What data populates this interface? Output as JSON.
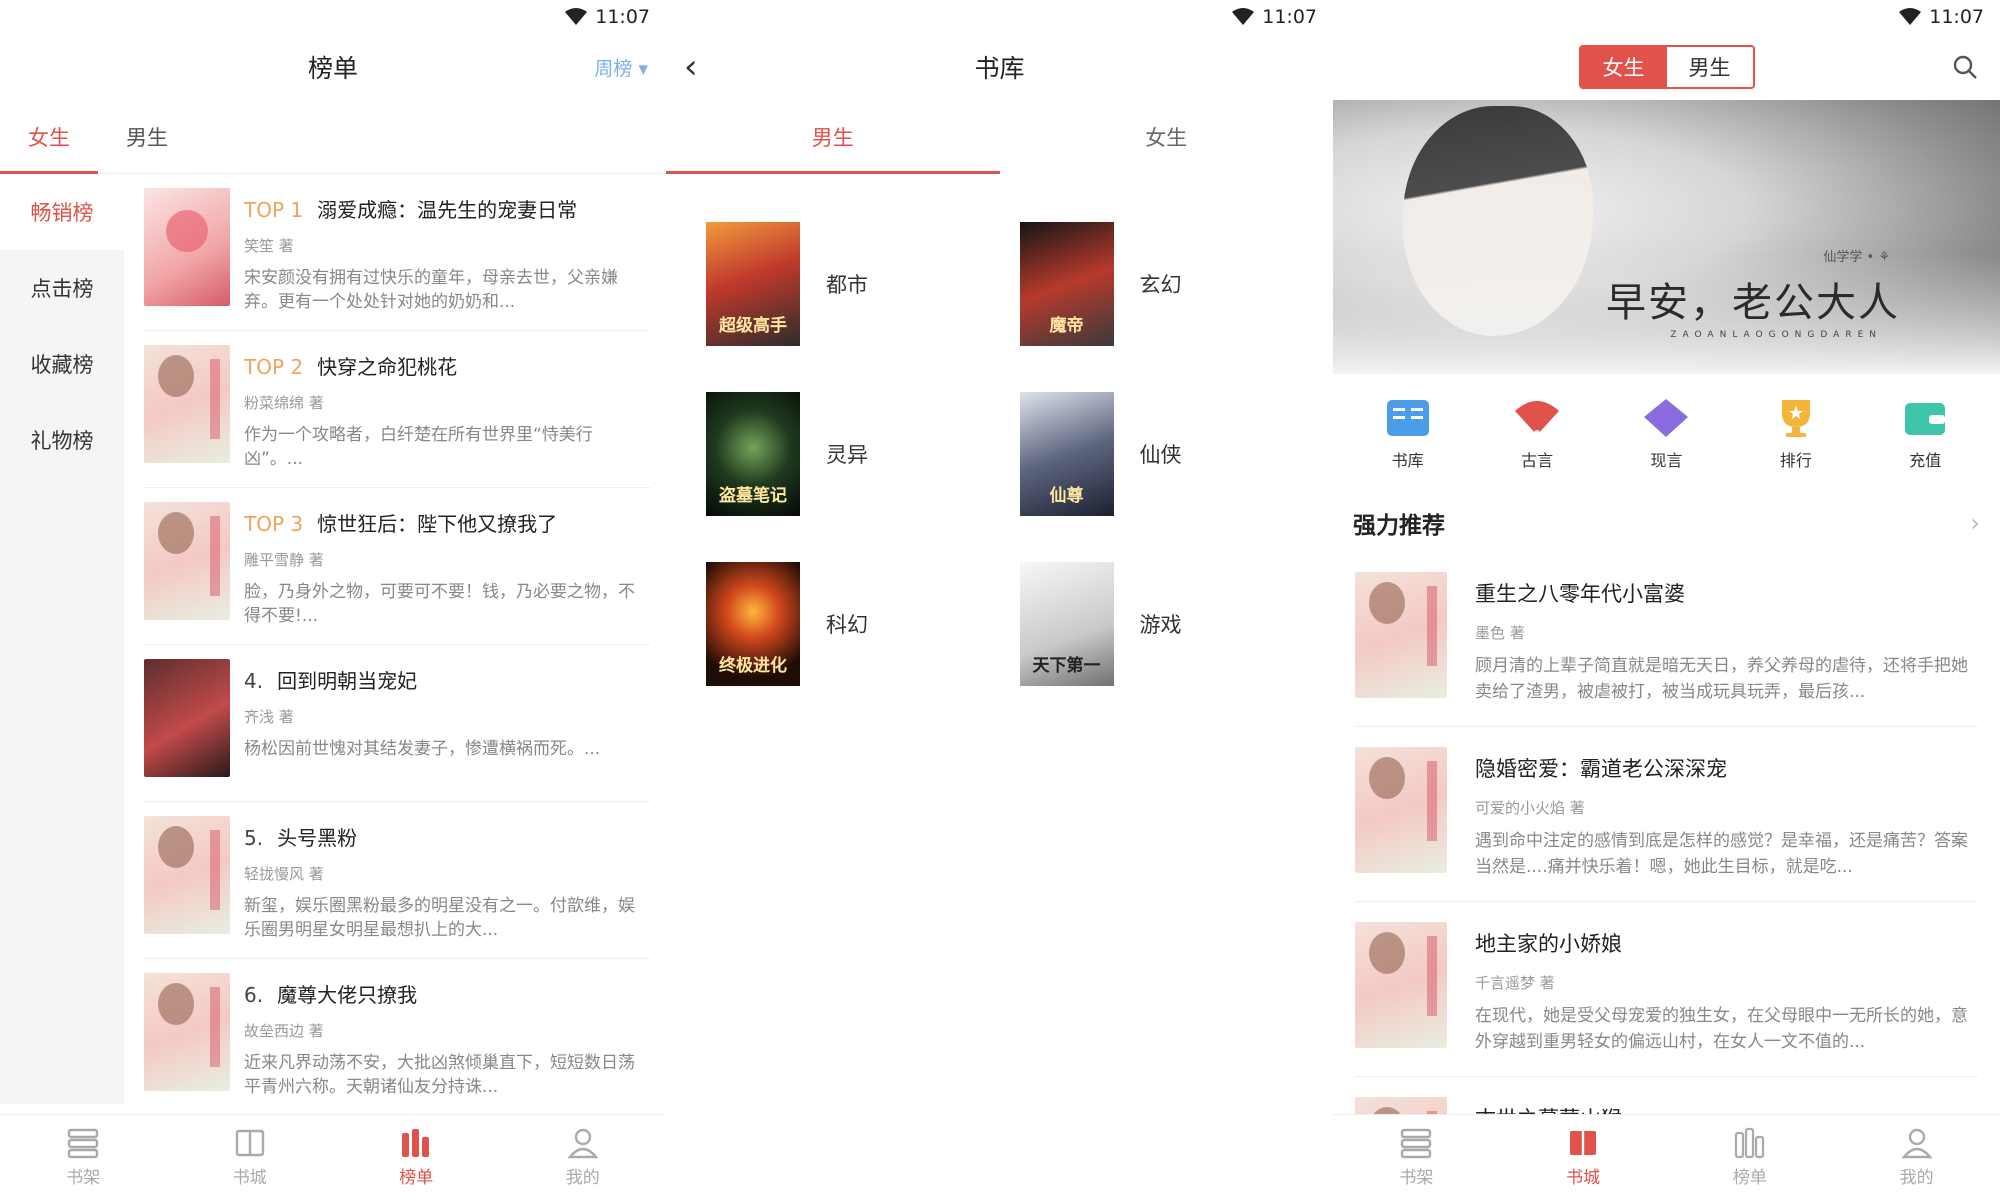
{
  "status_time": "11:07",
  "panel1": {
    "title": "榜单",
    "period": "周榜 ▾",
    "tabs": [
      "女生",
      "男生"
    ],
    "rank_nav": [
      "畅销榜",
      "点击榜",
      "收藏榜",
      "礼物榜"
    ],
    "books": [
      {
        "rank": "TOP 1",
        "title": "溺爱成瘾：温先生的宠妻日常",
        "author": "笑笙 著",
        "desc": "宋安颜没有拥有过快乐的童年，母亲去世，父亲嫌弃。更有一个处处针对她的奶奶和..."
      },
      {
        "rank": "TOP 2",
        "title": "快穿之命犯桃花",
        "author": "粉菜绵绵 著",
        "desc": "作为一个攻略者，白纤楚在所有世界里“恃美行凶”。..."
      },
      {
        "rank": "TOP 3",
        "title": "惊世狂后：陛下他又撩我了",
        "author": "雕平雪静 著",
        "desc": "脸，乃身外之物，可要可不要！钱，乃必要之物，不得不要!..."
      },
      {
        "rank": "4.",
        "title": "回到明朝当宠妃",
        "author": "齐浅 著",
        "desc": "杨松因前世愧对其结发妻子，惨遭横祸而死。..."
      },
      {
        "rank": "5.",
        "title": "头号黑粉",
        "author": "轻拢慢风 著",
        "desc": "新玺，娱乐圈黑粉最多的明星没有之一。付歆维，娱乐圈男明星女明星最想扒上的大..."
      },
      {
        "rank": "6.",
        "title": "魔尊大佬只撩我",
        "author": "故垒西边 著",
        "desc": "近来凡界动荡不安，大批凶煞倾巢直下，短短数日荡平青州六称。天朝诸仙友分持诛..."
      }
    ],
    "bottom_nav": [
      "书架",
      "书城",
      "榜单",
      "我的"
    ],
    "active_nav": 2
  },
  "panel2": {
    "back_icon": "‹",
    "title": "书库",
    "tabs": [
      "男生",
      "女生"
    ],
    "categories": [
      {
        "name": "都市",
        "cover_text": "超级高手"
      },
      {
        "name": "玄幻",
        "cover_text": "魔帝"
      },
      {
        "name": "灵异",
        "cover_text": "盗墓笔记"
      },
      {
        "name": "仙侠",
        "cover_text": "仙尊"
      },
      {
        "name": "科幻",
        "cover_text": "终极进化"
      },
      {
        "name": "游戏",
        "cover_text": "天下第一"
      }
    ]
  },
  "panel3": {
    "switch": [
      "女生",
      "男生"
    ],
    "banner": {
      "title": "早安，老公大人",
      "sub": "仙学学 • ⚘",
      "pinyin": "ZAOANLAOGONGDAREN"
    },
    "quick": [
      "书库",
      "古言",
      "现言",
      "排行",
      "充值"
    ],
    "section": "强力推荐",
    "recs": [
      {
        "title": "重生之八零年代小富婆",
        "author": "墨色 著",
        "desc": "顾月清的上辈子简直就是暗无天日，养父养母的虐待，还将手把她卖给了渣男，被虐被打，被当成玩具玩弄，最后孩..."
      },
      {
        "title": "隐婚密爱：霸道老公深深宠",
        "author": "可爱的小火焰 著",
        "desc": "遇到命中注定的感情到底是怎样的感觉？是幸福，还是痛苦？答案当然是....痛并快乐着！嗯，她此生目标，就是吃..."
      },
      {
        "title": "地主家的小娇娘",
        "author": "千言遥梦 著",
        "desc": "在现代，她是受父母宠爱的独生女，在父母眼中一无所长的她，意外穿越到重男轻女的偏远山村，在女人一文不值的..."
      },
      {
        "title": "古世之暮葬山猴",
        "author": "",
        "desc": ""
      }
    ],
    "bottom_nav": [
      "书架",
      "书城",
      "榜单",
      "我的"
    ],
    "active_nav": 1
  },
  "colors": {
    "accent": "#e0524a",
    "period": "#7bb1e8",
    "rank_gold": "#f0a35e"
  }
}
